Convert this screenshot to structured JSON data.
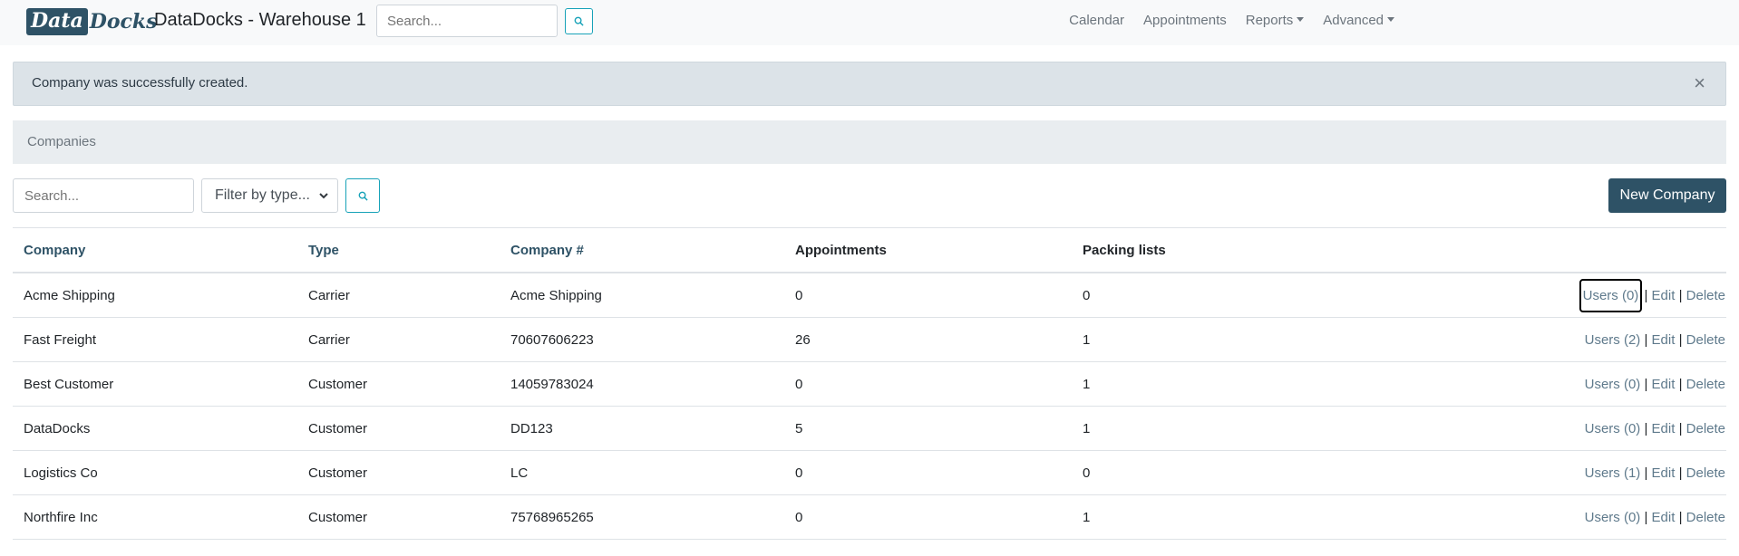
{
  "navbar": {
    "logo_left": "Data",
    "logo_right": "Docks",
    "title": "DataDocks - Warehouse 1",
    "search_placeholder": "Search...",
    "links": [
      {
        "label": "Calendar",
        "dropdown": false
      },
      {
        "label": "Appointments",
        "dropdown": false
      },
      {
        "label": "Reports",
        "dropdown": true
      },
      {
        "label": "Advanced",
        "dropdown": true
      }
    ]
  },
  "alert": {
    "message": "Company was successfully created.",
    "close": "×"
  },
  "card": {
    "header": "Companies"
  },
  "filters": {
    "search_placeholder": "Search...",
    "type_selected": "Filter by type...",
    "new_button": "New Company"
  },
  "table": {
    "headers": [
      "Company",
      "Type",
      "Company #",
      "Appointments",
      "Packing lists"
    ],
    "rows": [
      {
        "company": "Acme Shipping",
        "type": "Carrier",
        "number": "Acme Shipping",
        "appointments": "0",
        "packing": "0",
        "users": "Users (0)"
      },
      {
        "company": "Fast Freight",
        "type": "Carrier",
        "number": "70607606223",
        "appointments": "26",
        "packing": "1",
        "users": "Users (2)"
      },
      {
        "company": "Best Customer",
        "type": "Customer",
        "number": "14059783024",
        "appointments": "0",
        "packing": "1",
        "users": "Users (0)"
      },
      {
        "company": "DataDocks",
        "type": "Customer",
        "number": "DD123",
        "appointments": "5",
        "packing": "1",
        "users": "Users (0)"
      },
      {
        "company": "Logistics Co",
        "type": "Customer",
        "number": "LC",
        "appointments": "0",
        "packing": "0",
        "users": "Users (1)"
      },
      {
        "company": "Northfire Inc",
        "type": "Customer",
        "number": "75768965265",
        "appointments": "0",
        "packing": "1",
        "users": "Users (0)"
      }
    ],
    "edit_label": "Edit",
    "delete_label": "Delete",
    "separator": "|"
  },
  "colors": {
    "brand": "#2e5266",
    "alert_bg": "#dce3e8",
    "info_outline": "#17a2b8"
  },
  "icons": [
    "search-icon",
    "close-icon",
    "caret-down-icon",
    "chevron-down-icon"
  ]
}
